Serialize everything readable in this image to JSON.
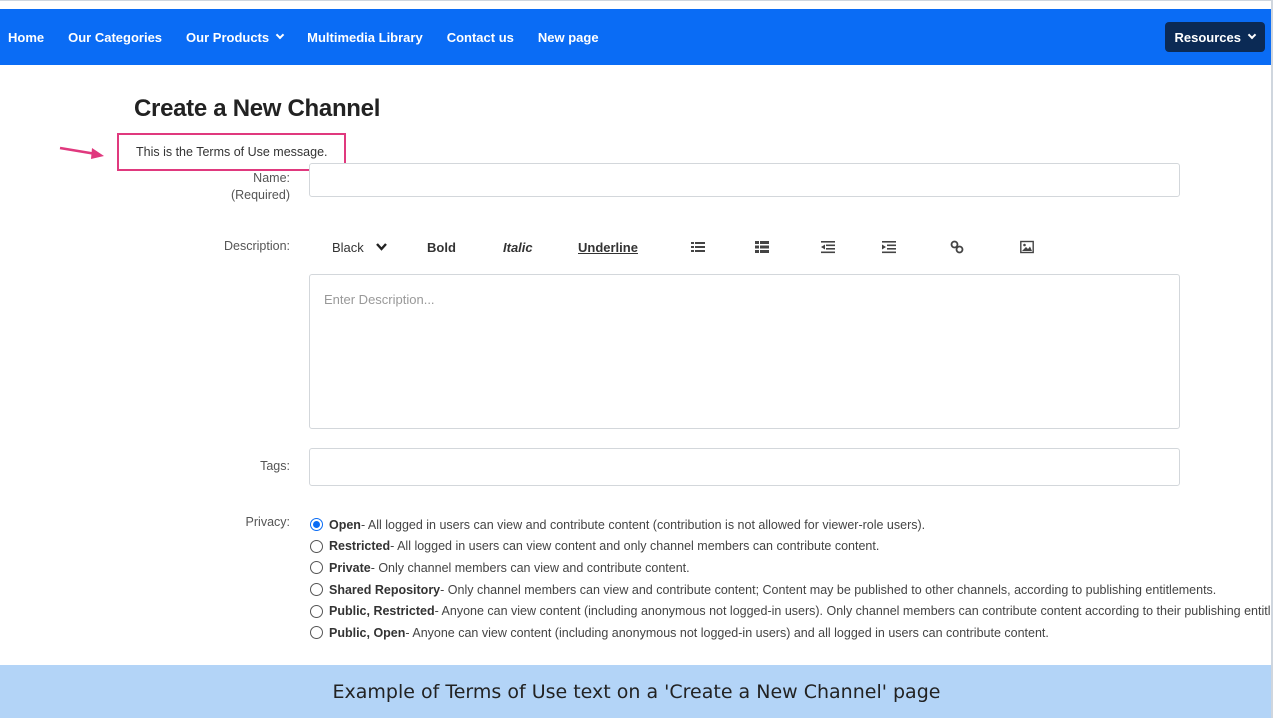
{
  "nav": {
    "items": [
      {
        "label": "Home"
      },
      {
        "label": "Our Categories"
      },
      {
        "label": "Our Products"
      },
      {
        "label": "Multimedia Library"
      },
      {
        "label": "Contact us"
      },
      {
        "label": "New page"
      }
    ],
    "resources_label": "Resources",
    "bar_color": "#0a6cf5",
    "resources_color": "#0b2a55"
  },
  "page": {
    "title": "Create a New Channel",
    "terms_message": "This is the Terms of Use message."
  },
  "form": {
    "name_label": "Name:",
    "name_required": "(Required)",
    "name_value": "",
    "description_label": "Description:",
    "description_placeholder": "Enter Description...",
    "toolbar": {
      "color_select": "Black",
      "bold": "Bold",
      "italic": "Italic",
      "underline": "Underline",
      "icons": [
        "ordered-list-icon",
        "unordered-list-icon",
        "outdent-icon",
        "indent-icon",
        "link-icon",
        "image-icon"
      ]
    },
    "tags_label": "Tags:",
    "tags_value": "",
    "privacy_label": "Privacy:",
    "privacy_options": [
      {
        "name": "Open",
        "desc": " - All logged in users can view and contribute content (contribution is not allowed for viewer-role users).",
        "checked": true
      },
      {
        "name": "Restricted",
        "desc": " - All logged in users can view content and only channel members can contribute content.",
        "checked": false
      },
      {
        "name": "Private",
        "desc": " - Only channel members can view and contribute content.",
        "checked": false
      },
      {
        "name": "Shared Repository",
        "desc": " - Only channel members can view and contribute content; Content may be published to other channels, according to publishing entitlements.",
        "checked": false
      },
      {
        "name": "Public, Restricted",
        "desc": " - Anyone can view content (including anonymous not logged-in users). Only channel members can contribute content according to their publishing entitlements.",
        "checked": false
      },
      {
        "name": "Public, Open",
        "desc": " - Anyone can view content (including anonymous not logged-in users) and all logged in users can contribute content.",
        "checked": false
      }
    ]
  },
  "caption": "Example of Terms of Use text on a 'Create a New Channel' page",
  "colors": {
    "highlight": "#e0397e",
    "caption_bg": "#b3d4f7"
  }
}
